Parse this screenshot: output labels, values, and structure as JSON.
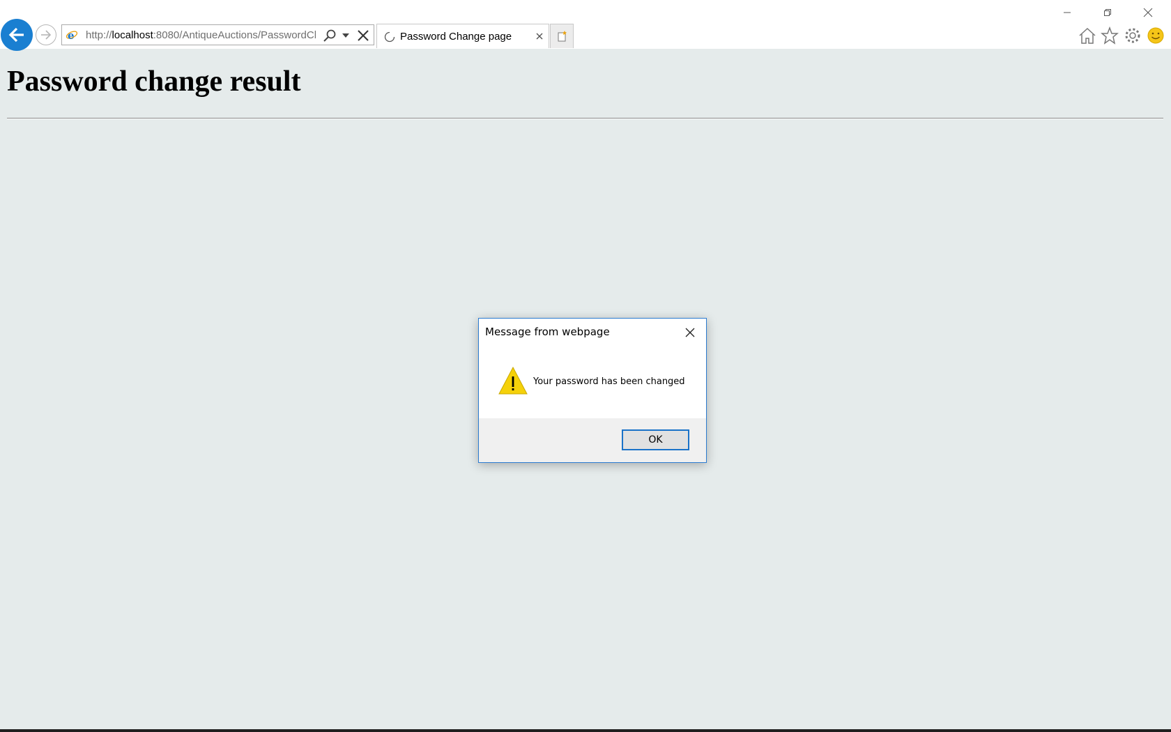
{
  "browser": {
    "address_bar": {
      "url_prefix": "http://",
      "url_host": "localhost",
      "url_rest": ":8080/AntiqueAuctions/PasswordCh"
    },
    "tab": {
      "title": "Password Change page"
    },
    "colors": {
      "accent": "#1a7fd1",
      "page_bg": "#e5ebeb"
    }
  },
  "page": {
    "heading": "Password change result"
  },
  "dialog": {
    "title": "Message from webpage",
    "icon": "warning-icon",
    "message": "Your password has been changed",
    "ok_label": "OK"
  },
  "icons": [
    "back-arrow-icon",
    "forward-arrow-icon",
    "ie-logo-icon",
    "search-icon",
    "dropdown-icon",
    "stop-icon",
    "loading-spinner-icon",
    "tab-close-icon",
    "new-tab-icon",
    "home-icon",
    "favorites-star-icon",
    "settings-gear-icon",
    "feedback-smiley-icon",
    "minimize-icon",
    "restore-icon",
    "window-close-icon",
    "dialog-close-icon",
    "warning-icon"
  ]
}
